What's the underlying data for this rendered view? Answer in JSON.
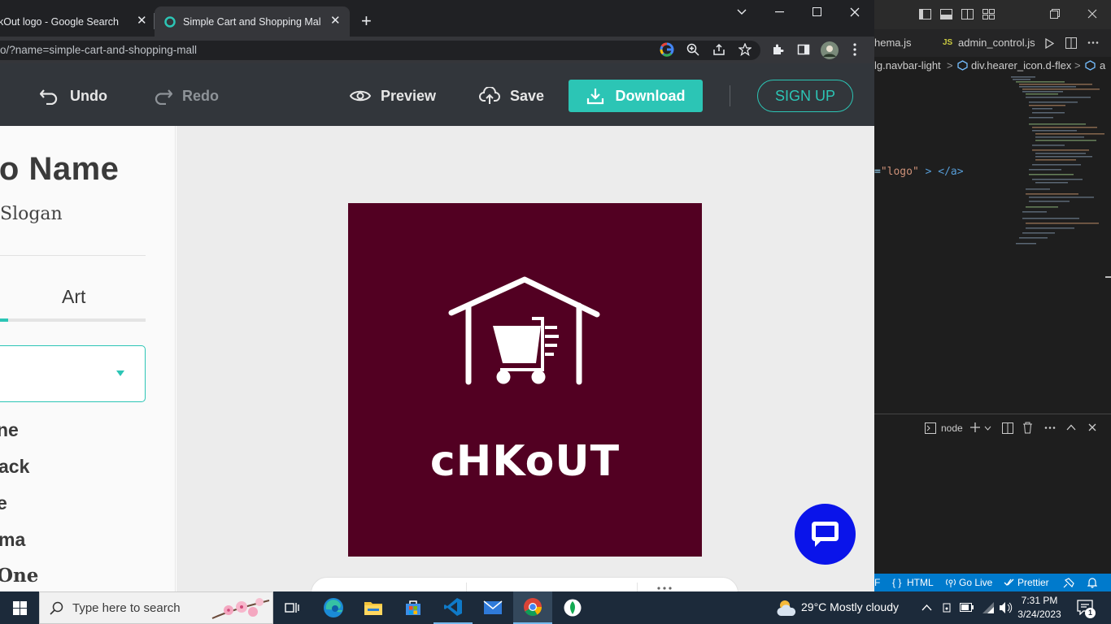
{
  "browser": {
    "tabs": [
      {
        "title": "kOut logo - Google Search",
        "close": "✕"
      },
      {
        "title": "Simple Cart and Shopping Mall L",
        "close": "✕"
      }
    ],
    "new_tab": "+",
    "address": "o/?name=simple-cart-and-shopping-mall"
  },
  "editor": {
    "toolbar": {
      "undo": "Undo",
      "redo": "Redo",
      "preview": "Preview",
      "save": "Save",
      "download": "Download",
      "signup": "SIGN UP"
    },
    "panel": {
      "logo_name": "go Name",
      "slogan": "Slogan",
      "tab_art": "Art",
      "font_items": [
        "ne",
        "ack",
        "e",
        "ma",
        "One"
      ]
    },
    "logo": {
      "brand": "cHKoUT",
      "background": "#520022",
      "icon": "house-cart-icon"
    },
    "accent": "#2cc5b5",
    "chat_color": "#0a14ea"
  },
  "vscode": {
    "tabs": [
      "hema.js",
      "JS",
      "admin_control.js"
    ],
    "breadcrumb_1": "lg.navbar-light",
    "breadcrumb_sep": ">",
    "breadcrumb_2": "div.hearer_icon.d-flex",
    "breadcrumb_3": "a",
    "code_attr": "=",
    "code_string": "\"logo\"",
    "code_close": "> </a>",
    "terminal_label": "node",
    "status": {
      "eol": "F",
      "lang": "HTML",
      "golive": "Go Live",
      "prettier": "Prettier"
    }
  },
  "taskbar": {
    "search_placeholder": "Type here to search",
    "weather": "29°C  Mostly cloudy",
    "time": "7:31 PM",
    "date": "3/24/2023",
    "notifications": "1"
  }
}
